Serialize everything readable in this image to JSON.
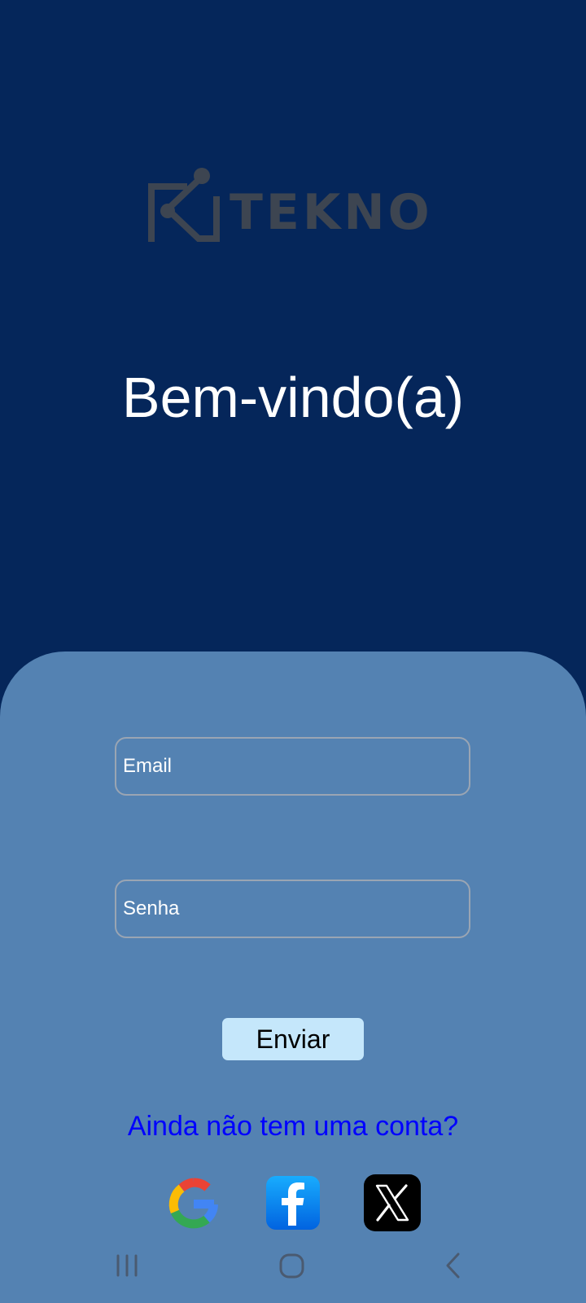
{
  "brand": {
    "name": "TEKNO",
    "logo_icon": "circuit-n-logo-icon",
    "text_color": "#3d4551"
  },
  "welcome": {
    "title": "Bem-vindo(a)"
  },
  "form": {
    "email_placeholder": "Email",
    "password_placeholder": "Senha",
    "email_value": "",
    "password_value": "",
    "submit_label": "Enviar",
    "signup_link": "Ainda não tem uma conta?"
  },
  "social_logins": [
    {
      "icon": "google-icon"
    },
    {
      "icon": "facebook-icon"
    },
    {
      "icon": "x-icon"
    }
  ],
  "navbar": {
    "icons": [
      "recent-apps-icon",
      "home-icon",
      "back-icon"
    ]
  },
  "colors": {
    "background": "#05265a",
    "panel": "#5482b2",
    "button": "#c5e7fb",
    "link": "#0000ff",
    "text": "#ffffff"
  }
}
